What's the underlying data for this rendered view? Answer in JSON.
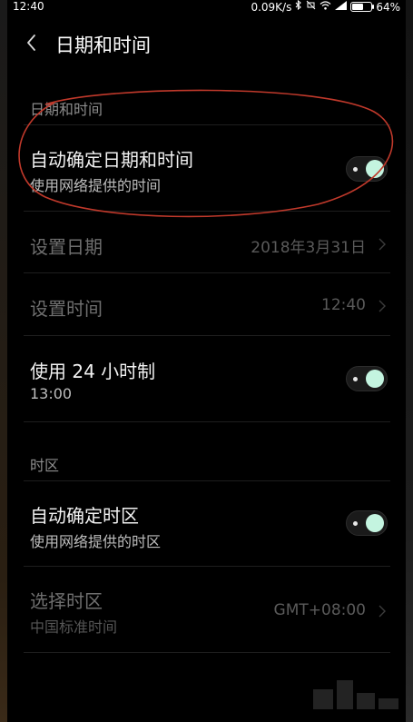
{
  "status_bar": {
    "time": "12:40",
    "network_speed": "0.09K/s",
    "battery_percent": "64%",
    "battery_level": 0.64
  },
  "header": {
    "title": "日期和时间"
  },
  "sections": [
    {
      "header": "日期和时间",
      "rows": [
        {
          "title": "自动确定日期和时间",
          "subtitle": "使用网络提供的时间",
          "toggle_on": true
        },
        {
          "title": "设置日期",
          "value": "2018年3月31日",
          "disabled": true
        },
        {
          "title": "设置时间",
          "value": "12:40",
          "disabled": true
        },
        {
          "title": "使用 24 小时制",
          "subtitle": "13:00",
          "toggle_on": true
        }
      ]
    },
    {
      "header": "时区",
      "rows": [
        {
          "title": "自动确定时区",
          "subtitle": "使用网络提供的时区",
          "toggle_on": true
        },
        {
          "title": "选择时区",
          "subtitle": "中国标准时间",
          "value": "GMT+08:00",
          "disabled": true
        }
      ]
    }
  ],
  "colors": {
    "background": "#000000",
    "toggle_knob": "#c4f4e0",
    "annotation": "#c0392b"
  },
  "icons": {
    "back": "back-chevron-icon",
    "chevron": "chevron-right-icon",
    "bluetooth": "bluetooth-icon",
    "wifi": "wifi-icon",
    "signal": "signal-icon",
    "battery": "battery-icon"
  }
}
